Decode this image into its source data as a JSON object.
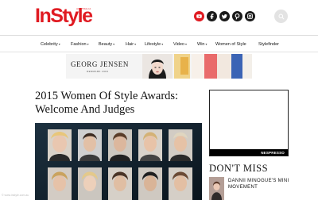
{
  "header": {
    "logo": "InStyle",
    "logo_tag": "AUSTRALIA",
    "social": [
      "youtube-icon",
      "facebook-icon",
      "twitter-icon",
      "pinterest-icon",
      "instagram-icon"
    ],
    "accent_color": "#e01b22"
  },
  "nav": {
    "items": [
      {
        "label": "Celebrity",
        "dropdown": true
      },
      {
        "label": "Fashion",
        "dropdown": true
      },
      {
        "label": "Beauty",
        "dropdown": true
      },
      {
        "label": "Hair",
        "dropdown": true
      },
      {
        "label": "Lifestyle",
        "dropdown": true
      },
      {
        "label": "Video",
        "dropdown": true
      },
      {
        "label": "Win",
        "dropdown": true
      },
      {
        "label": "Women of Style",
        "dropdown": false
      },
      {
        "label": "Stylefinder",
        "dropdown": false
      }
    ]
  },
  "ad_banner": {
    "brand": "GEORG JENSEN",
    "sub": "DENMARK 1904"
  },
  "article": {
    "title": "2015 Women Of Style Awards: Welcome And Judges",
    "watermark": "© www.instyle.com.au"
  },
  "sidebar": {
    "ad_brand": "NESPRESSO",
    "section_heading": "DON'T MISS",
    "story_title": "DANNII MINOGUE'S MINI MOVEMENT"
  }
}
